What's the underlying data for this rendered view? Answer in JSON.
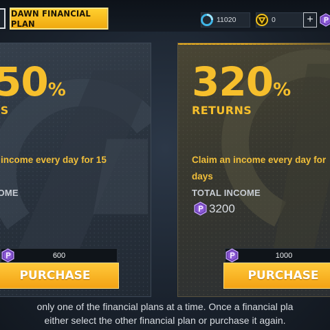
{
  "header": {
    "tab_title": "DAWN FINANCIAL PLAN",
    "coins": "11020",
    "gems": "0",
    "plus_label": "+"
  },
  "plans": [
    {
      "returns_number": "50",
      "returns_suffix": "%",
      "returns_label": "NS",
      "description_line1": "income every day for 15",
      "total_label": "COME",
      "total_value": "",
      "price": "600",
      "button_label": "PURCHASE"
    },
    {
      "returns_number": "320",
      "returns_suffix": "%",
      "returns_label": "RETURNS",
      "description_line1": "Claim an income every day for",
      "description_line2": "days",
      "total_label": "TOTAL INCOME",
      "total_value": "3200",
      "price": "1000",
      "button_label": "PURCHASE"
    }
  ],
  "footer": {
    "line1": "only one of the financial plans at a time. Once a financial pla",
    "line2": "either select the other financial plan or purchase it again."
  },
  "colors": {
    "accent_gold": "#f6bf2c",
    "gem_purple": "#9b6ad8",
    "panel": "#2c3540"
  },
  "icons": {
    "coin": "cyan-ring-coin-icon",
    "token": "yellow-triangle-token-icon",
    "gem": "purple-p-gem-icon"
  }
}
